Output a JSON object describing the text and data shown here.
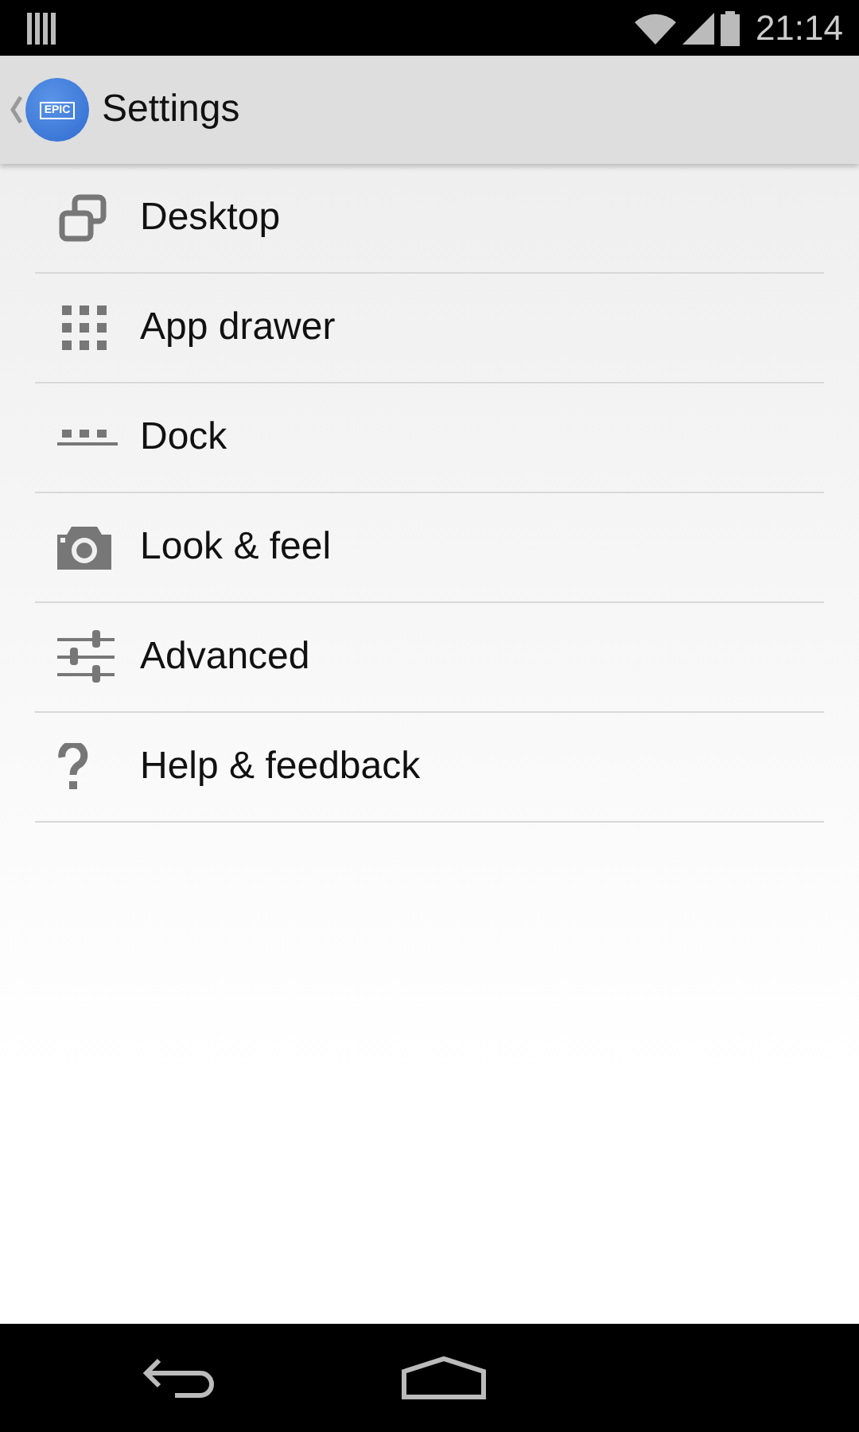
{
  "status_bar": {
    "time": "21:14"
  },
  "app_bar": {
    "logo_text": "EPIC",
    "title": "Settings"
  },
  "items": [
    {
      "label": "Desktop",
      "kind": "desktop"
    },
    {
      "label": "App drawer",
      "kind": "grid"
    },
    {
      "label": "Dock",
      "kind": "dock"
    },
    {
      "label": "Look & feel",
      "kind": "camera"
    },
    {
      "label": "Advanced",
      "kind": "sliders"
    },
    {
      "label": "Help & feedback",
      "kind": "help"
    }
  ],
  "nav_bar": {
    "buttons": [
      {
        "kind": "back"
      },
      {
        "kind": "home"
      }
    ]
  }
}
